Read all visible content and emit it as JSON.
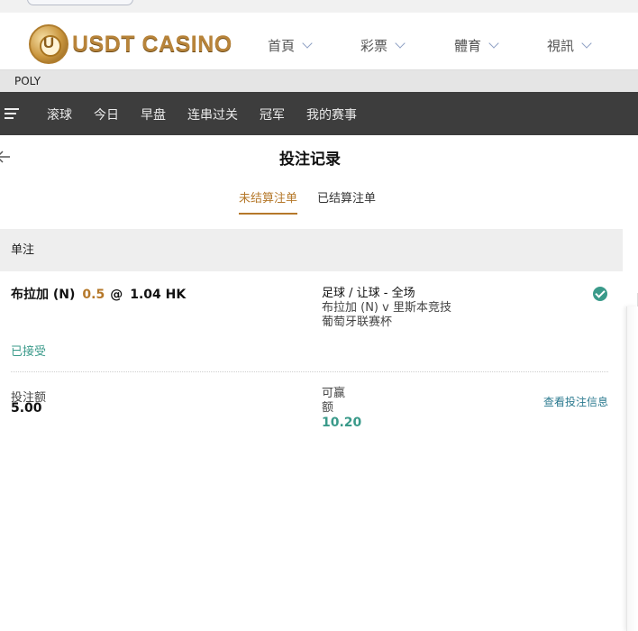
{
  "header": {
    "logo_text": "USDT CASINO",
    "logo_badge_letter": "U",
    "nav": [
      {
        "label": "首頁"
      },
      {
        "label": "彩票"
      },
      {
        "label": "體育"
      },
      {
        "label": "視訊"
      }
    ]
  },
  "provider_bar": {
    "label": "POLY"
  },
  "sports_nav": {
    "items": [
      "滚球",
      "今日",
      "早盘",
      "连串过关",
      "冠军",
      "我的赛事"
    ]
  },
  "page": {
    "title": "投注记录",
    "tabs": [
      {
        "label": "未结算注单",
        "active": true
      },
      {
        "label": "已结算注单",
        "active": false
      }
    ]
  },
  "section": {
    "label": "单注"
  },
  "bet": {
    "selection": "布拉加 (N)",
    "handicap": "0.5",
    "at": "@",
    "odds": "1.04 HK",
    "market": "足球 / 让球 - 全场",
    "match": "布拉加 (N) v 里斯本竞技",
    "league": "葡萄牙联赛杯",
    "status": "已接受",
    "stake_label": "投注额",
    "stake_value": "5.00",
    "win_label": "可赢额",
    "win_value": "10.20",
    "view_info_label": "查看投注信息"
  },
  "colors": {
    "accent_gold": "#b5782a",
    "accent_teal": "#3a9a8a",
    "nav_bar_bg": "#3d3d3d"
  }
}
